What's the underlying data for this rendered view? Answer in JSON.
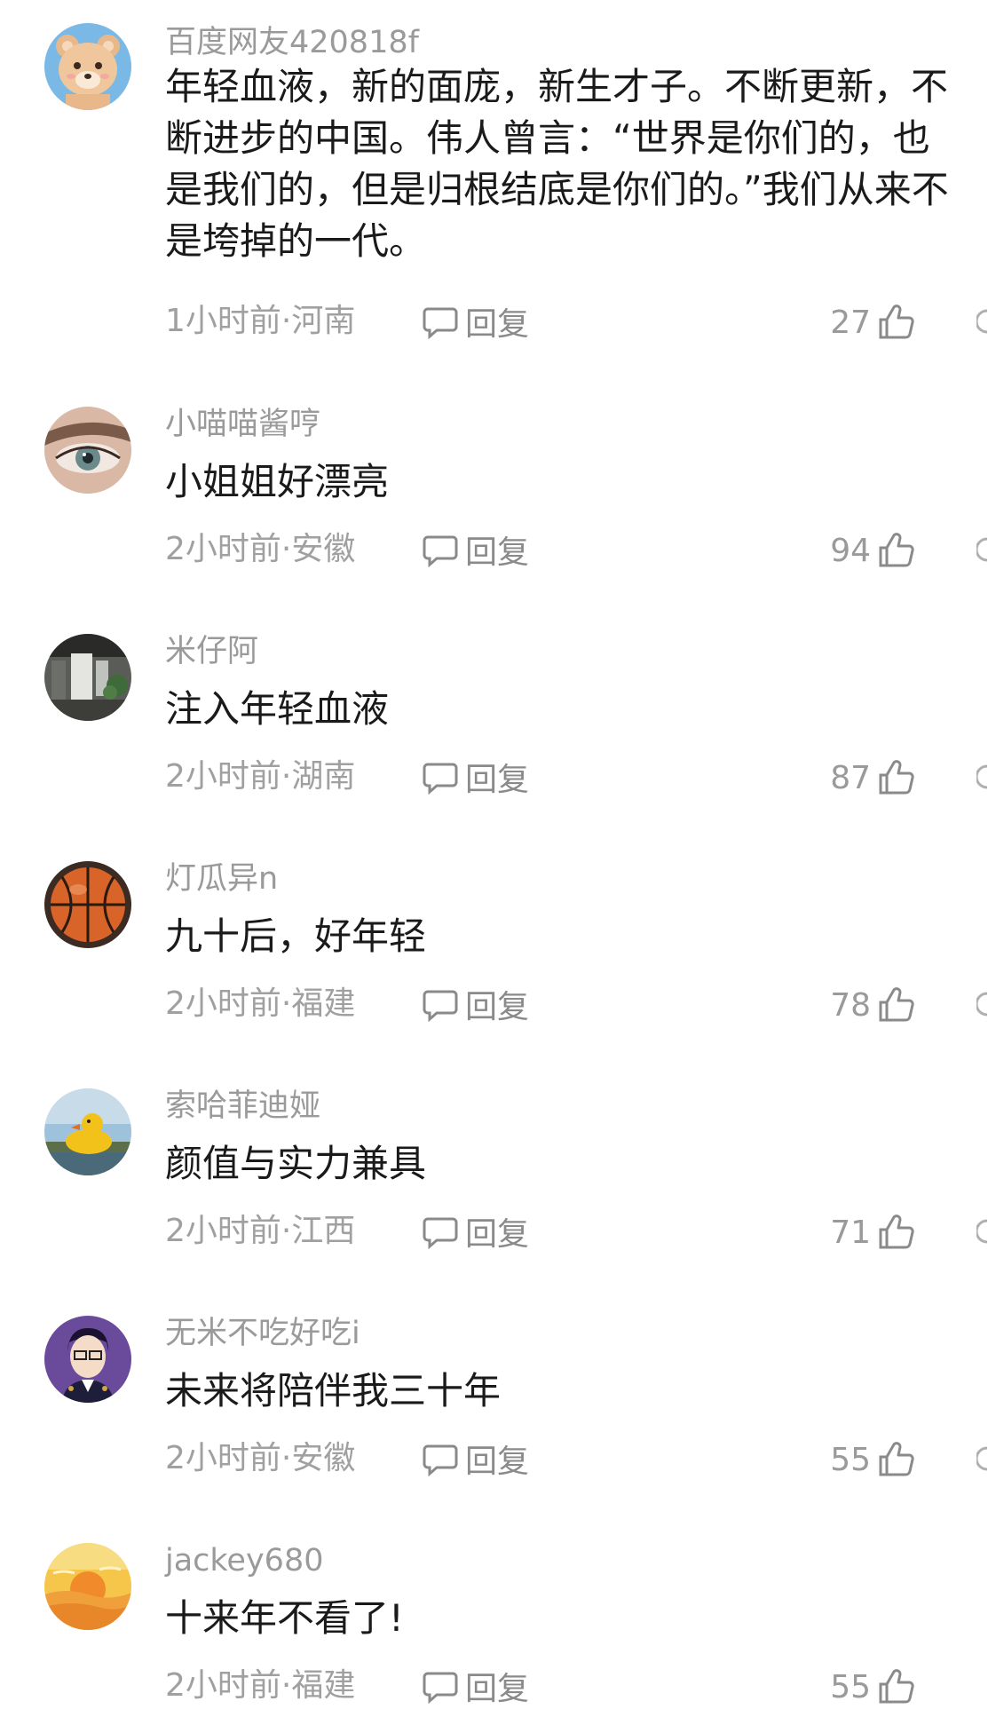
{
  "reply_label": "回复",
  "comments": [
    {
      "username": "百度网友420818f",
      "text": "年轻血液，新的面庞，新生才子。不断更新，不断进步的中国。伟人曾言：“世界是你们的，也是我们的，但是归根结底是你们的。”我们从来不是垮掉的一代。",
      "meta": "1小时前·河南",
      "likes": "27",
      "avatar": "bear-avatar"
    },
    {
      "username": "小喵喵酱哼",
      "text": "小姐姐好漂亮",
      "meta": "2小时前·安徽",
      "likes": "94",
      "avatar": "eye-avatar"
    },
    {
      "username": "米仔阿",
      "text": "注入年轻血液",
      "meta": "2小时前·湖南",
      "likes": "87",
      "avatar": "room-avatar"
    },
    {
      "username": "灯瓜异n",
      "text": "九十后，好年轻",
      "meta": "2小时前·福建",
      "likes": "78",
      "avatar": "basketball-avatar"
    },
    {
      "username": "索哈菲迪娅",
      "text": "颜值与实力兼具",
      "meta": "2小时前·江西",
      "likes": "71",
      "avatar": "duck-avatar"
    },
    {
      "username": "无米不吃好吃i",
      "text": "未来将陪伴我三十年",
      "meta": "2小时前·安徽",
      "likes": "55",
      "avatar": "cartoon-man-avatar"
    },
    {
      "username": "jackey680",
      "text": "十来年不看了!",
      "meta": "2小时前·福建",
      "likes": "55",
      "avatar": "sunset-avatar"
    }
  ]
}
